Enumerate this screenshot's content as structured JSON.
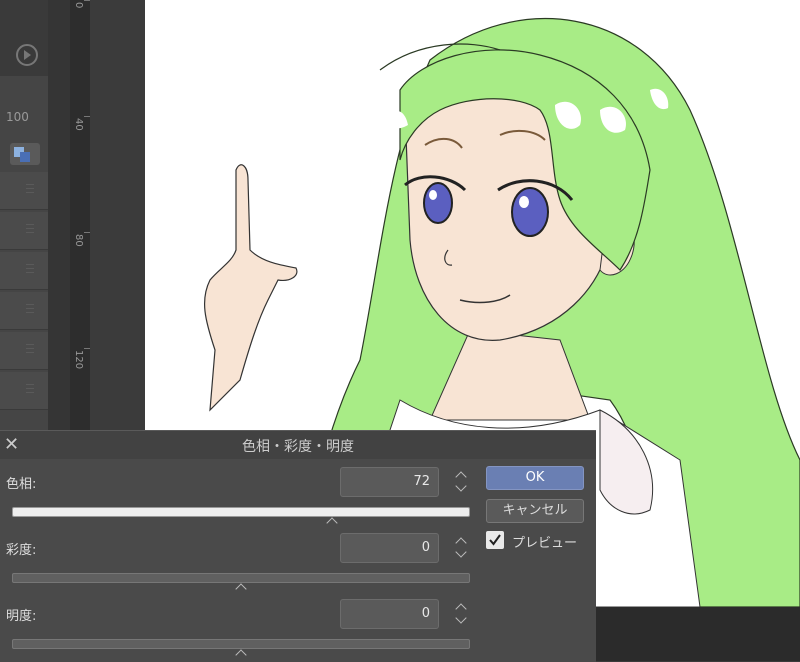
{
  "left_panel": {
    "opacity_value": "100"
  },
  "ruler": {
    "ticks": [
      "0",
      "40",
      "80",
      "120"
    ]
  },
  "dialog": {
    "title": "色相・彩度・明度",
    "close_glyph": "✕",
    "hue": {
      "label": "色相:",
      "value": "72"
    },
    "saturation": {
      "label": "彩度:",
      "value": "0"
    },
    "lightness": {
      "label": "明度:",
      "value": "0"
    },
    "ok_label": "OK",
    "cancel_label": "キャンセル",
    "preview_label": "プレビュー",
    "preview_checked": true
  },
  "colors": {
    "accent": "#6a7fb3",
    "hair": "#a8ec86",
    "skin": "#f8e4d4",
    "eye": "#5b5fc0"
  }
}
